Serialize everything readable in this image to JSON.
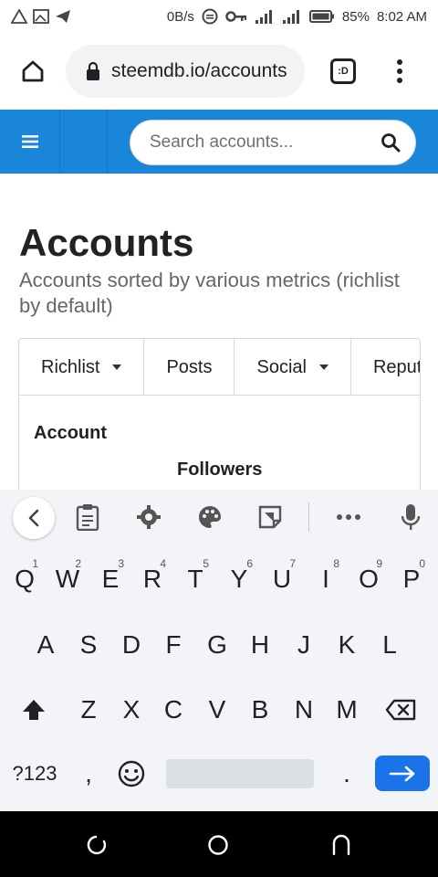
{
  "status_bar": {
    "net_speed": "0B/s",
    "battery": "85%",
    "time": "8:02 AM"
  },
  "browser": {
    "url": "steemdb.io/accounts",
    "tab_label": ":D"
  },
  "search": {
    "placeholder": "Search accounts..."
  },
  "page": {
    "title": "Accounts",
    "subtitle": "Accounts sorted by various metrics (richlist by default)"
  },
  "tabs": [
    {
      "label": "Richlist"
    },
    {
      "label": "Posts"
    },
    {
      "label": "Social"
    },
    {
      "label": "Reputation"
    }
  ],
  "table": {
    "col_account": "Account",
    "col_followers": "Followers"
  },
  "keyboard": {
    "row1": [
      {
        "key": "Q",
        "num": "1"
      },
      {
        "key": "W",
        "num": "2"
      },
      {
        "key": "E",
        "num": "3"
      },
      {
        "key": "R",
        "num": "4"
      },
      {
        "key": "T",
        "num": "5"
      },
      {
        "key": "Y",
        "num": "6"
      },
      {
        "key": "U",
        "num": "7"
      },
      {
        "key": "I",
        "num": "8"
      },
      {
        "key": "O",
        "num": "9"
      },
      {
        "key": "P",
        "num": "0"
      }
    ],
    "row2": [
      "A",
      "S",
      "D",
      "F",
      "G",
      "H",
      "J",
      "K",
      "L"
    ],
    "row3": [
      "Z",
      "X",
      "C",
      "V",
      "B",
      "N",
      "M"
    ],
    "symbols_label": "?123",
    "comma": ",",
    "period": "."
  },
  "colors": {
    "navbar": "#1a86d9",
    "enter_key": "#1a73e8"
  },
  "icons": {
    "home": "home-icon",
    "lock": "lock-icon",
    "menu": "more-vert-icon",
    "search": "search-icon",
    "hamburger": "hamburger-icon"
  }
}
